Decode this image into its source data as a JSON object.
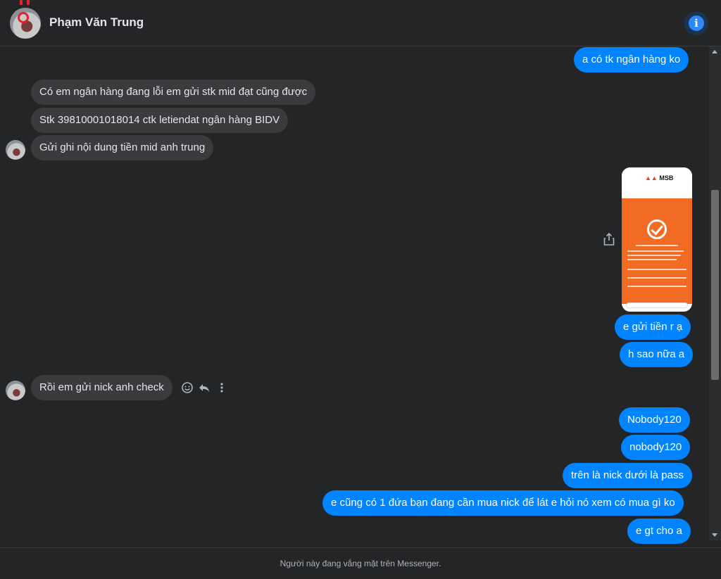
{
  "header": {
    "name": "Phạm Văn Trung",
    "info_icon": "info-icon"
  },
  "messages": [
    {
      "from": "me",
      "text": "a có tk ngân hàng ko"
    },
    {
      "from": "them",
      "text": "Có em ngân hàng đang lỗi em gửi stk mid đạt cũng được"
    },
    {
      "from": "them",
      "text": "Stk 39810001018014 ctk letiendat ngân hàng BIDV"
    },
    {
      "from": "them",
      "text": "Gửi ghi nội dung tiền mid anh trung"
    },
    {
      "from": "me",
      "text": "e gửi tiền r ạ"
    },
    {
      "from": "me",
      "text": "h sao nữa a"
    },
    {
      "from": "them",
      "text": "Rồi em gửi nick anh check"
    },
    {
      "from": "me",
      "text": "Nobody120"
    },
    {
      "from": "me",
      "text": "nobody120"
    },
    {
      "from": "me",
      "text": "trên là nick dưới là pass"
    },
    {
      "from": "me",
      "text": "e cũng có 1 đứa bạn đang cần mua nick để lát e hỏi nó xem có mua gì ko"
    },
    {
      "from": "me",
      "text": "e gt cho a"
    }
  ],
  "photo": {
    "brand": "MSB"
  },
  "footer": {
    "status_text": "Người này đang vắng mặt trên Messenger."
  },
  "colors": {
    "background": "#242526",
    "incoming_bubble": "#3a3b3c",
    "outgoing_bubble": "#0084ff",
    "accent": "#2d88ff"
  }
}
